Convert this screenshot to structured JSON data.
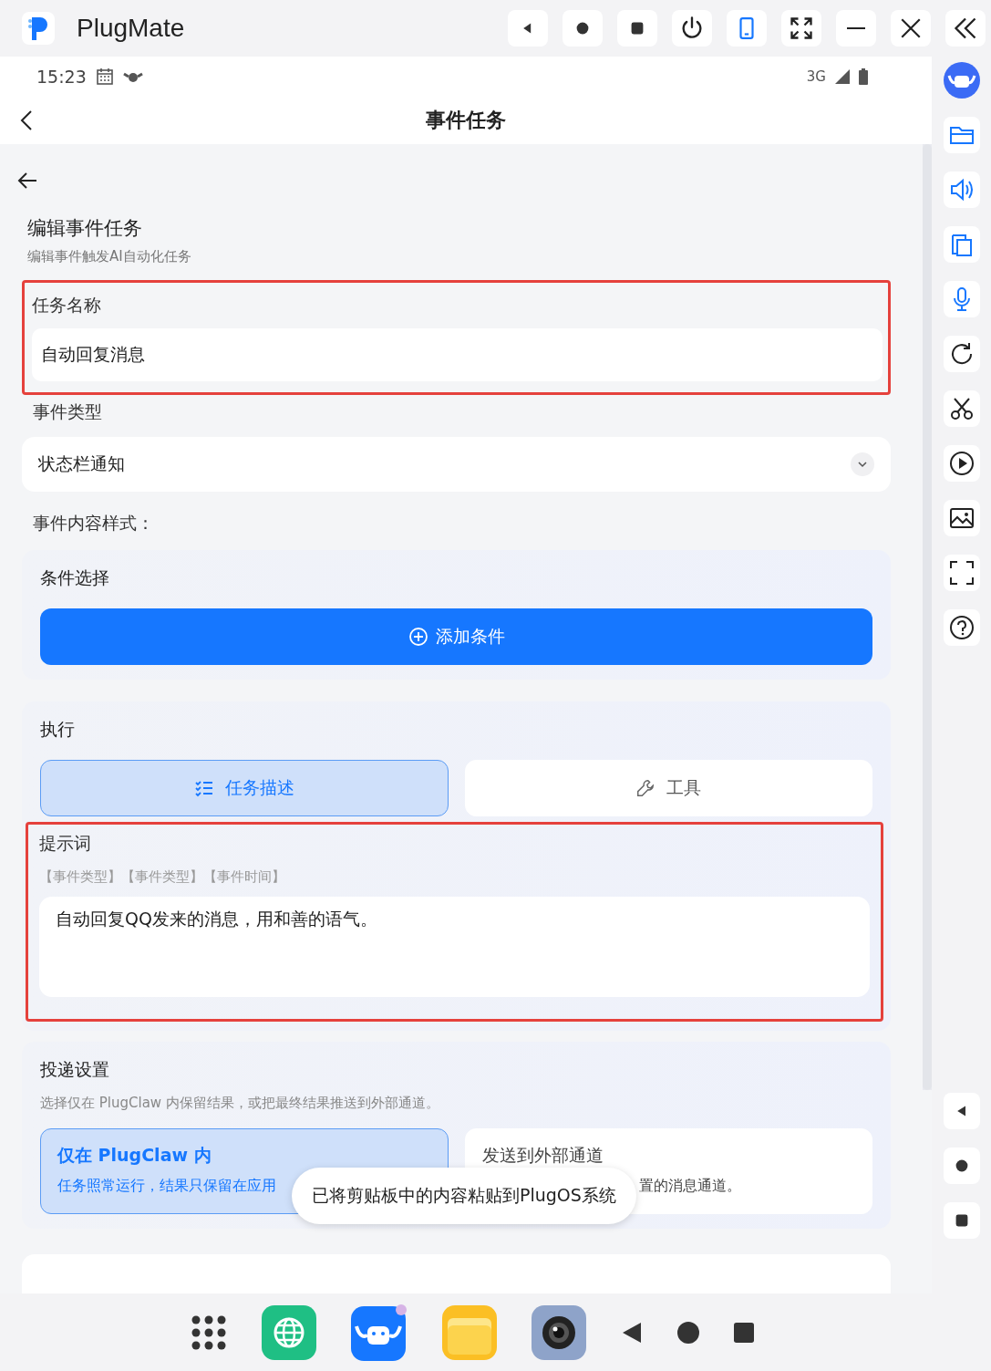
{
  "window": {
    "title": "PlugMate"
  },
  "status_bar": {
    "time": "15:23",
    "network": "3G"
  },
  "header": {
    "title": "事件任务"
  },
  "page": {
    "heading": "编辑事件任务",
    "subheading": "编辑事件触发AI自动化任务"
  },
  "task_name": {
    "label": "任务名称",
    "value": "自动回复消息",
    "highlighted": true
  },
  "event_type": {
    "label": "事件类型",
    "value": "状态栏通知"
  },
  "event_content_label": "事件内容样式：",
  "conditions": {
    "title": "条件选择",
    "button": "添加条件"
  },
  "execute": {
    "title": "执行",
    "tabs": [
      {
        "label": "任务描述",
        "selected": true,
        "kind": "list"
      },
      {
        "label": "工具",
        "selected": false,
        "kind": "wrench"
      }
    ],
    "prompt": {
      "label": "提示词",
      "hint": "【事件类型】【事件类型】【事件时间】",
      "value": "自动回复QQ发来的消息，用和善的语气。",
      "highlighted": true
    }
  },
  "delivery": {
    "title": "投递设置",
    "description": "选择仅在 PlugClaw 内保留结果，或把最终结果推送到外部通道。",
    "options": [
      {
        "title": "仅在 PlugClaw 内",
        "description": "任务照常运行，结果只保留在应用",
        "selected": true
      },
      {
        "title": "发送到外部通道",
        "description": "置的消息通道。",
        "selected": false
      }
    ]
  },
  "toast": "已将剪贴板中的内容粘贴到PlugOS系统"
}
